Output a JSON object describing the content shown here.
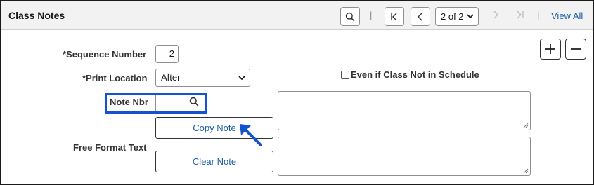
{
  "header": {
    "title": "Class Notes",
    "page_select": "2 of 2",
    "view_all": "View All",
    "separator": "|"
  },
  "form": {
    "sequence_number": {
      "label": "*Sequence Number",
      "value": "2"
    },
    "print_location": {
      "label": "*Print Location",
      "value": "After"
    },
    "even_if": {
      "label": "Even if Class Not in Schedule",
      "checked": false
    },
    "note_nbr": {
      "label": "Note Nbr",
      "value": ""
    },
    "copy_note": "Copy Note",
    "free_format": {
      "label": "Free Format Text"
    },
    "clear_note": "Clear Note"
  },
  "icons": {
    "search": "search-icon",
    "first": "first-page-icon",
    "previous": "previous-icon",
    "next": "next-icon",
    "last": "last-page-icon",
    "add": "plus-icon",
    "remove": "minus-icon",
    "pointer": "arrow-pointer-icon"
  },
  "colors": {
    "link": "#1f5fa8",
    "highlight": "#1352d0",
    "header_bg": "#f2f2f2"
  }
}
